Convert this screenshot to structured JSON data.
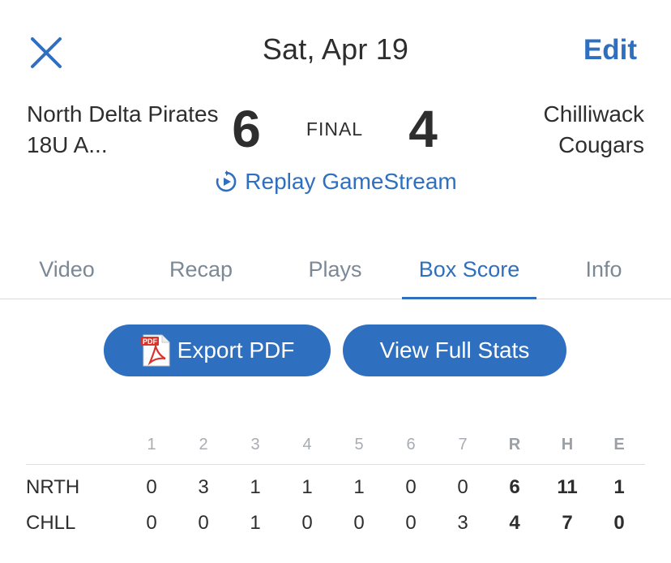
{
  "header": {
    "date": "Sat, Apr 19",
    "edit_label": "Edit"
  },
  "game": {
    "home_team": "North Delta Pirates 18U A...",
    "away_team": "Chilliwack Cougars",
    "home_score": "6",
    "away_score": "4",
    "status": "FINAL",
    "replay_label": "Replay GameStream"
  },
  "tabs": [
    {
      "label": "Video"
    },
    {
      "label": "Recap"
    },
    {
      "label": "Plays"
    },
    {
      "label": "Box Score"
    },
    {
      "label": "Info"
    }
  ],
  "active_tab": "Box Score",
  "actions": {
    "export_label": "Export PDF",
    "pdf_icon_text": "PDF",
    "full_stats_label": "View Full Stats"
  },
  "linescore": {
    "innings": [
      "1",
      "2",
      "3",
      "4",
      "5",
      "6",
      "7"
    ],
    "totals_headers": [
      "R",
      "H",
      "E"
    ],
    "rows": [
      {
        "team": "NRTH",
        "innings": [
          "0",
          "3",
          "1",
          "1",
          "1",
          "0",
          "0"
        ],
        "totals": [
          "6",
          "11",
          "1"
        ]
      },
      {
        "team": "CHLL",
        "innings": [
          "0",
          "0",
          "1",
          "0",
          "0",
          "0",
          "3"
        ],
        "totals": [
          "4",
          "7",
          "0"
        ]
      }
    ]
  },
  "colors": {
    "accent": "#2f6fbf",
    "text": "#2e2e2e",
    "muted_tab": "#7b8896"
  }
}
